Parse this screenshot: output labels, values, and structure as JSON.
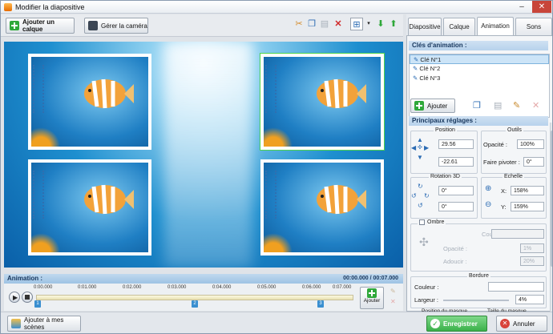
{
  "window": {
    "title": "Modifier la diapositive"
  },
  "toolbar": {
    "add_layer_label": "Ajouter un calque",
    "camera_label": "Gérer la caméra"
  },
  "tabs": [
    {
      "label": "Diapositive"
    },
    {
      "label": "Calque"
    },
    {
      "label": "Animation"
    },
    {
      "label": "Sons"
    }
  ],
  "keys": {
    "title": "Clés d'animation :",
    "items": [
      "Clé N°1",
      "Clé N°2",
      "Clé N°3"
    ],
    "add_label": "Ajouter"
  },
  "settings": {
    "title": "Principaux réglages :",
    "position_label": "Position",
    "pos_x": "29.56",
    "pos_y": "-22.61",
    "tools_label": "Outils",
    "opacity_label": "Opacité :",
    "opacity_value": "100%",
    "pivot_label": "Faire pivoter :",
    "pivot_value": "0°",
    "rotation_label": "Rotation 3D",
    "rot_1": "0°",
    "rot_2": "0°",
    "scale_label": "Echelle",
    "scale_x_label": "X:",
    "scale_x": "158%",
    "scale_y_label": "Y:",
    "scale_y": "159%",
    "shadow_label": "Ombre",
    "shadow_color_label": "Couleur :",
    "shadow_opacity_label": "Opacité :",
    "shadow_opacity_value": "1%",
    "shadow_soften_label": "Adoucir :",
    "shadow_soften_value": "20%",
    "border_label": "Bordure",
    "border_color_label": "Couleur :",
    "border_width_label": "Largeur :",
    "border_width_value": "4%",
    "cut_1": "Position du masque",
    "cut_2": "Taille du masque"
  },
  "timeline": {
    "title": "Animation :",
    "time": "00:00.000 / 00:07.000",
    "ticks": [
      "0:00.000",
      "0:01.000",
      "0:02.000",
      "0:03.000",
      "0:04.000",
      "0:05.000",
      "0:06.000",
      "0:07.000"
    ],
    "keys": [
      "1",
      "2",
      "3"
    ],
    "add_label": "Ajouter"
  },
  "bottom": {
    "add_scenes_label": "Ajouter à mes scènes",
    "save_label": "Enregistrer",
    "cancel_label": "Annuler"
  },
  "colors": {
    "accent": "#2b6bb3",
    "save_green": "#3bb14a",
    "selection": "#cce4f7"
  }
}
